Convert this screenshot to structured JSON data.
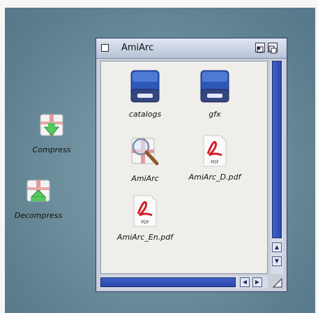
{
  "desktop": {
    "icons": [
      {
        "label": "Compress",
        "icon": "package-compress-icon"
      },
      {
        "label": "Decompress",
        "icon": "package-decompress-icon"
      }
    ]
  },
  "window": {
    "title": "AmiArc",
    "files": [
      {
        "label": "catalogs",
        "icon": "drawer-icon"
      },
      {
        "label": "gfx",
        "icon": "drawer-icon"
      },
      {
        "label": "AmiArc",
        "icon": "magnifier-tool-icon"
      },
      {
        "label": "AmiArc_D.pdf",
        "icon": "pdf-icon"
      },
      {
        "label": "AmiArc_En.pdf",
        "icon": "pdf-icon"
      }
    ],
    "pdf_badge": "PDF"
  },
  "colors": {
    "scroll_blue": "#3356be",
    "pdf_red": "#d3202a",
    "drawer_blue": "#2c58b7"
  }
}
